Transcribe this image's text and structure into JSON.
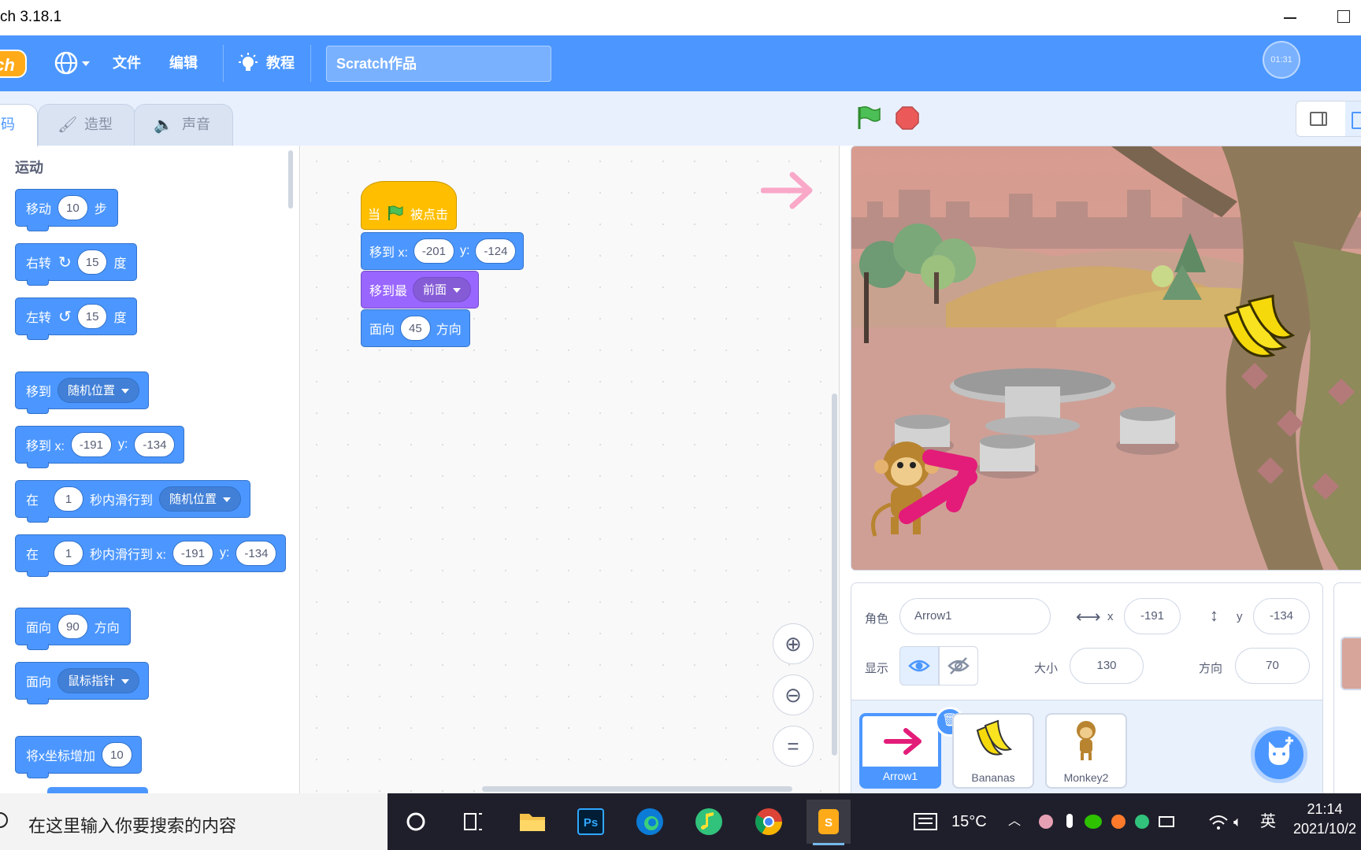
{
  "window": {
    "title": "ch 3.18.1"
  },
  "menubar": {
    "logo_text": "ch",
    "file": "文件",
    "edit": "编辑",
    "tutorials": "教程",
    "project_title": "Scratch作品",
    "timer": "01:31"
  },
  "tabs": {
    "code": "码",
    "costumes": "造型",
    "sounds": "声音"
  },
  "palette": {
    "category": "运动",
    "blocks": {
      "move": {
        "label": "移动",
        "steps": "10",
        "unit": "步"
      },
      "turn_right": {
        "label": "右转",
        "degrees": "15",
        "unit": "度"
      },
      "turn_left": {
        "label": "左转",
        "degrees": "15",
        "unit": "度"
      },
      "goto": {
        "label": "移到",
        "target": "随机位置"
      },
      "goto_xy": {
        "label": "移到 x:",
        "x": "-191",
        "ylabel": "y:",
        "y": "-134"
      },
      "glide_to": {
        "label1": "在",
        "secs": "1",
        "label2": "秒内滑行到",
        "target": "随机位置"
      },
      "glide_xy": {
        "label1": "在",
        "secs": "1",
        "label2": "秒内滑行到 x:",
        "x": "-191",
        "ylabel": "y:",
        "y": "-134"
      },
      "point_dir": {
        "label": "面向",
        "dir": "90",
        "unit": "方向"
      },
      "point_towards": {
        "label": "面向",
        "target": "鼠标指针"
      },
      "change_x": {
        "label": "将x坐标增加",
        "value": "10"
      }
    }
  },
  "script": {
    "hat": {
      "label1": "当",
      "label2": "被点击"
    },
    "goto_xy": {
      "label": "移到 x:",
      "x": "-201",
      "ylabel": "y:",
      "y": "-124"
    },
    "front": {
      "label": "移到最",
      "option": "前面"
    },
    "point": {
      "label": "面向",
      "dir": "45",
      "unit": "方向"
    }
  },
  "sprite_info": {
    "sprite_label": "角色",
    "sprite_name": "Arrow1",
    "x_label": "x",
    "x": "-191",
    "y_label": "y",
    "y": "-134",
    "show_label": "显示",
    "size_label": "大小",
    "size": "130",
    "direction_label": "方向",
    "direction": "70"
  },
  "sprites": [
    {
      "name": "Arrow1",
      "selected": true
    },
    {
      "name": "Bananas",
      "selected": false
    },
    {
      "name": "Monkey2",
      "selected": false
    }
  ],
  "taskbar": {
    "search_placeholder": "在这里输入你要搜索的内容",
    "weather": "15°C",
    "ime": "英",
    "time": "21:14",
    "date": "2021/10/2"
  },
  "colors": {
    "motion": "#4c97ff",
    "looks": "#9966ff",
    "events": "#ffbf00",
    "menubar": "#4c97ff"
  }
}
